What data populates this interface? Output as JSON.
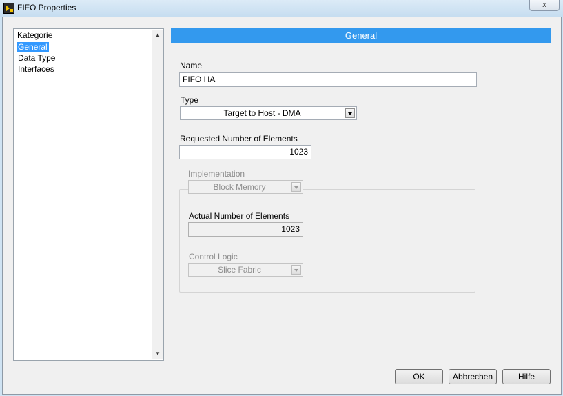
{
  "window": {
    "title": "FIFO Properties",
    "close_label": "x"
  },
  "sidebar": {
    "header": "Kategorie",
    "items": [
      {
        "label": "General",
        "selected": true
      },
      {
        "label": "Data Type",
        "selected": false
      },
      {
        "label": "Interfaces",
        "selected": false
      }
    ]
  },
  "main": {
    "section_title": "General",
    "name": {
      "label": "Name",
      "value": "FIFO HA"
    },
    "type": {
      "label": "Type",
      "value": "Target to Host - DMA"
    },
    "requested": {
      "label": "Requested Number of Elements",
      "value": "1023"
    },
    "implementation": {
      "label": "Implementation",
      "value": "Block Memory",
      "enabled": false
    },
    "actual": {
      "label": "Actual Number of Elements",
      "value": "1023"
    },
    "control_logic": {
      "label": "Control Logic",
      "value": "Slice Fabric",
      "enabled": false
    }
  },
  "buttons": {
    "ok": "OK",
    "cancel": "Abbrechen",
    "help": "Hilfe"
  },
  "colors": {
    "accent": "#3399ee",
    "selection": "#3399ff"
  }
}
